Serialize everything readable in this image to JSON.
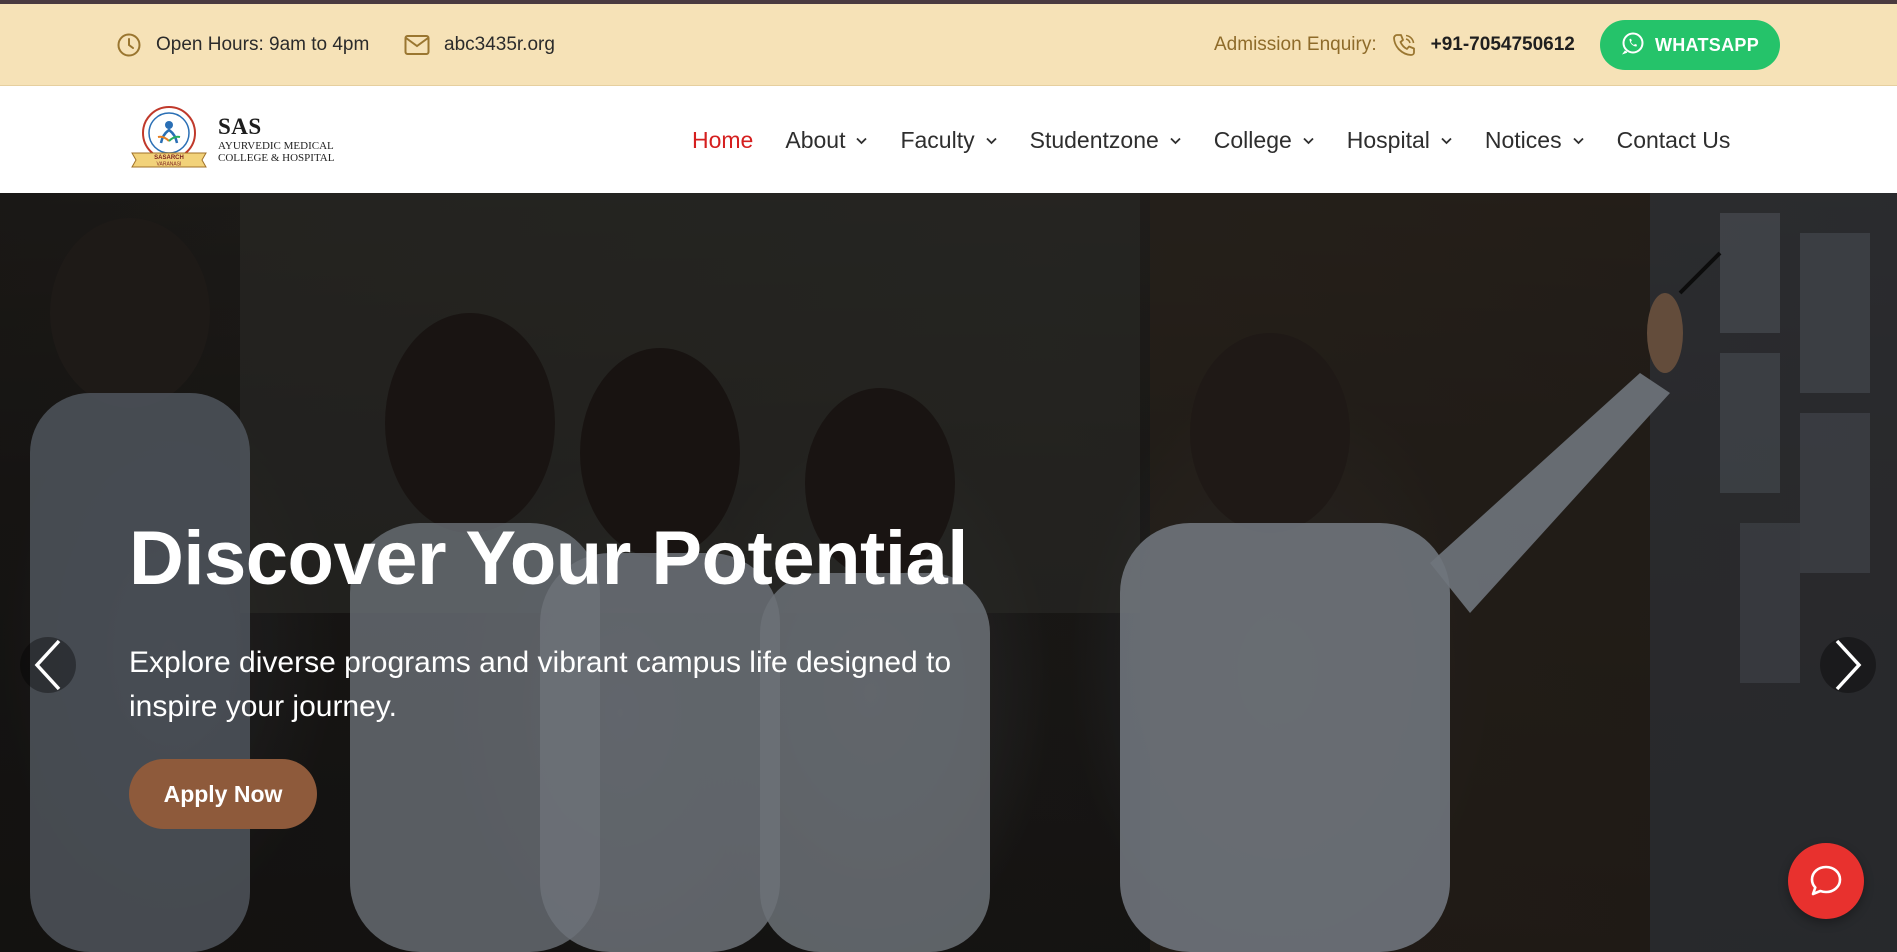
{
  "topbar": {
    "hours_text": "Open Hours: 9am to 4pm",
    "email": "abc3435r.org",
    "enquiry_label": "Admission Enquiry:",
    "phone": "+91-7054750612",
    "whatsapp_label": "WHATSAPP",
    "accent": "#8e6b2a",
    "whatsapp_color": "#25c36a"
  },
  "brand": {
    "name": "SAS",
    "subtitle_line1": "AYURVEDIC MEDICAL",
    "subtitle_line2": "COLLEGE & HOSPITAL",
    "emblem_text": "SASARCH VARANASI"
  },
  "nav": {
    "items": [
      {
        "label": "Home",
        "has_dropdown": false,
        "active": true
      },
      {
        "label": "About",
        "has_dropdown": true,
        "active": false
      },
      {
        "label": "Faculty",
        "has_dropdown": true,
        "active": false
      },
      {
        "label": "Studentzone",
        "has_dropdown": true,
        "active": false
      },
      {
        "label": "College",
        "has_dropdown": true,
        "active": false
      },
      {
        "label": "Hospital",
        "has_dropdown": true,
        "active": false
      },
      {
        "label": "Notices",
        "has_dropdown": true,
        "active": false
      },
      {
        "label": "Contact Us",
        "has_dropdown": false,
        "active": false
      }
    ],
    "active_color": "#d51f1f"
  },
  "hero": {
    "title": "Discover Your Potential",
    "subtitle": "Explore diverse programs and vibrant campus life designed to inspire your journey.",
    "cta_label": "Apply Now",
    "cta_color": "#8e5a3b",
    "prev_icon": "chevron-left-icon",
    "next_icon": "chevron-right-icon"
  },
  "chat": {
    "icon": "chat-bubble-icon",
    "color": "#e8312e"
  }
}
